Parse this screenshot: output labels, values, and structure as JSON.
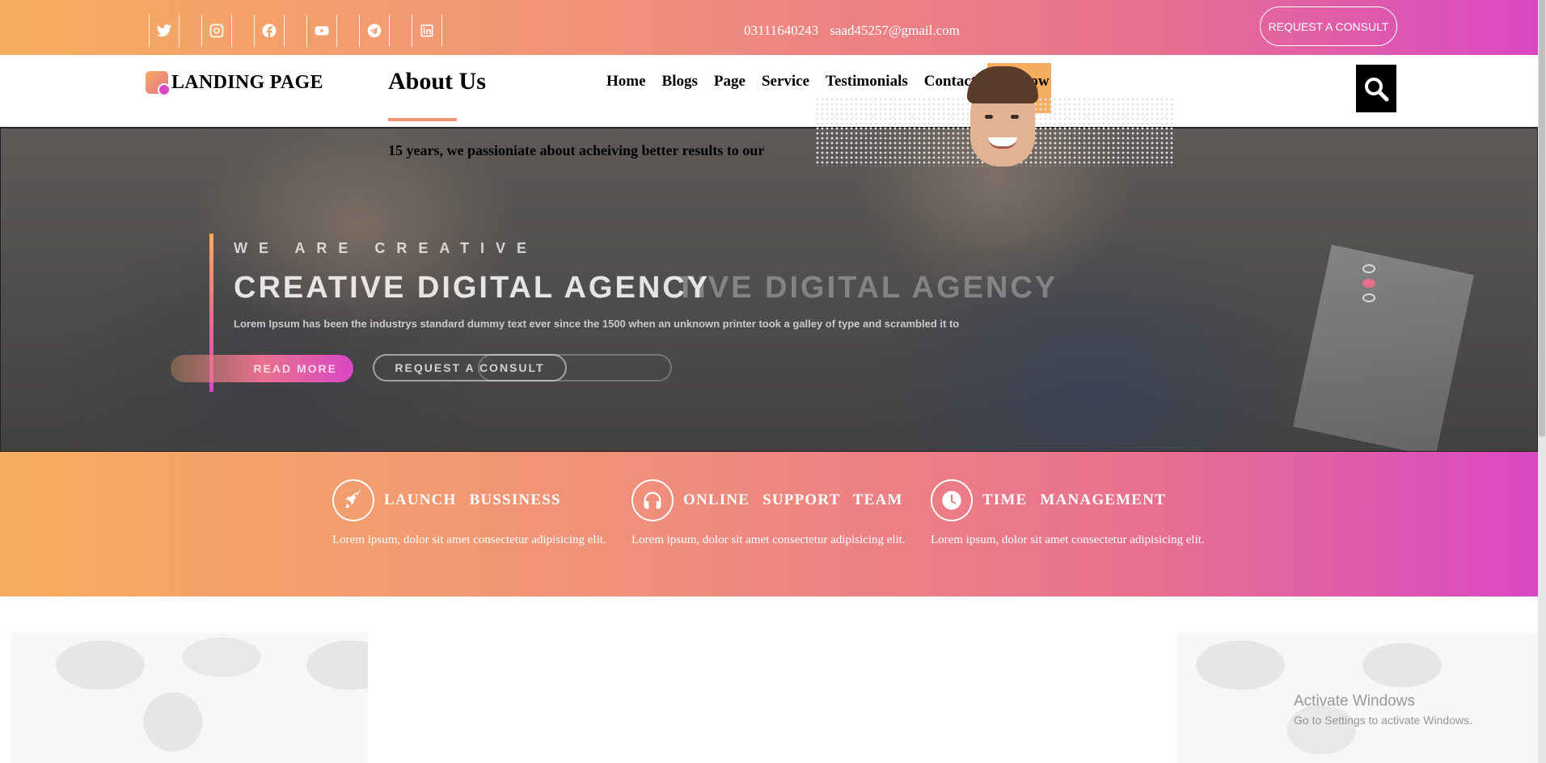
{
  "topbar": {
    "social": [
      {
        "icon": "twitter-icon"
      },
      {
        "icon": "instagram-icon"
      },
      {
        "icon": "facebook-icon"
      },
      {
        "icon": "youtube-icon"
      },
      {
        "icon": "telegram-icon"
      },
      {
        "icon": "linkedin-icon"
      }
    ],
    "phone": "03111640243",
    "email": "saad45257@gmail.com",
    "consult_label": "REQUEST A CONSULT"
  },
  "nav": {
    "logo_text": "LANDING PAGE",
    "items": [
      "Home",
      "Blogs",
      "Page",
      "Service",
      "Testimonials",
      "Contact"
    ],
    "buy_now": "Buy Now",
    "search_icon": "search-icon"
  },
  "hero": {
    "eyebrow": "WE ARE CREATIVE",
    "headline": "CREATIVE DIGITAL AGENCY",
    "headline_ghost": "TIVE DIGITAL AGENCY",
    "description": "Lorem Ipsum has been the industrys standard dummy text ever since the 1500 when an unknown printer took a galley of type and scrambled it to",
    "read_more": "READ MORE",
    "request_consult": "REQUEST A CONSULT",
    "slides": 3,
    "active_slide": 2
  },
  "features": [
    {
      "icon": "rocket-icon",
      "title": "LAUNCH BUSSINESS",
      "text": "Lorem ipsum, dolor sit amet consectetur adipisicing elit."
    },
    {
      "icon": "headphones-icon",
      "title": "ONLINE SUPPORT TEAM",
      "text": "Lorem ipsum, dolor sit amet consectetur adipisicing elit."
    },
    {
      "icon": "clock-icon",
      "title": "TIME MANAGEMENT",
      "text": "Lorem ipsum, dolor sit amet consectetur adipisicing elit."
    }
  ],
  "about": {
    "title": "About Us",
    "text": "15 years, we passioniate about acheiving better results to our"
  },
  "watermark": {
    "line1": "Activate Windows",
    "line2": "Go to Settings to activate Windows."
  },
  "colors": {
    "gradient_start": "#f6ad5f",
    "gradient_mid": "#e8708f",
    "gradient_end": "#d948c4"
  }
}
